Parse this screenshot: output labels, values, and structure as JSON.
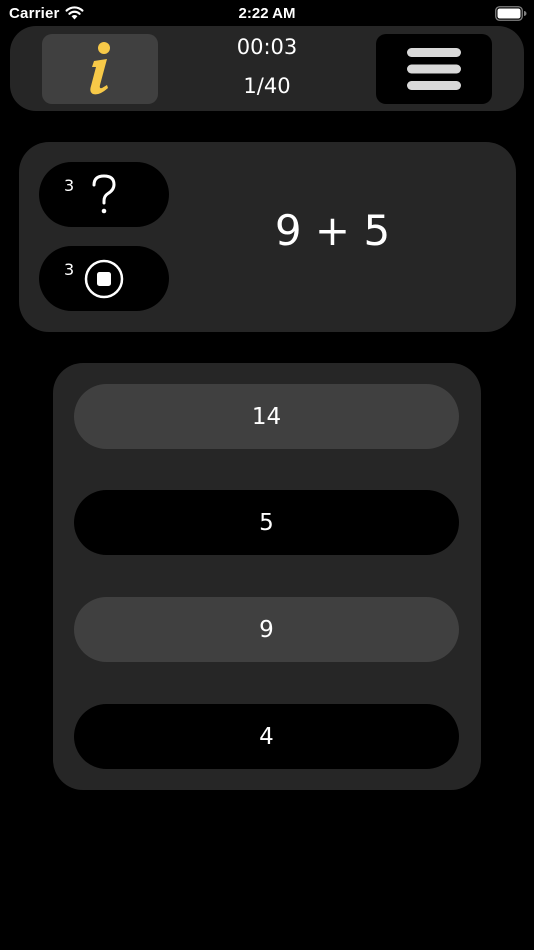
{
  "status_bar": {
    "carrier": "Carrier",
    "time": "2:22 AM"
  },
  "toolbar": {
    "timer": "00:03",
    "progress": "1/40",
    "info_icon": "info-icon",
    "menu_icon": "hamburger-menu-icon"
  },
  "helpers": [
    {
      "count": "3",
      "icon": "question-mark-icon"
    },
    {
      "count": "3",
      "icon": "stop-icon"
    }
  ],
  "question": {
    "equation": "9 + 5"
  },
  "answers": [
    {
      "label": "14",
      "style": "grey"
    },
    {
      "label": "5",
      "style": "black"
    },
    {
      "label": "9",
      "style": "grey"
    },
    {
      "label": "4",
      "style": "black"
    }
  ],
  "colors": {
    "background": "#000000",
    "panel": "#262626",
    "button_grey": "#404040",
    "info_accent": "#f7c948",
    "text": "#ffffff"
  }
}
